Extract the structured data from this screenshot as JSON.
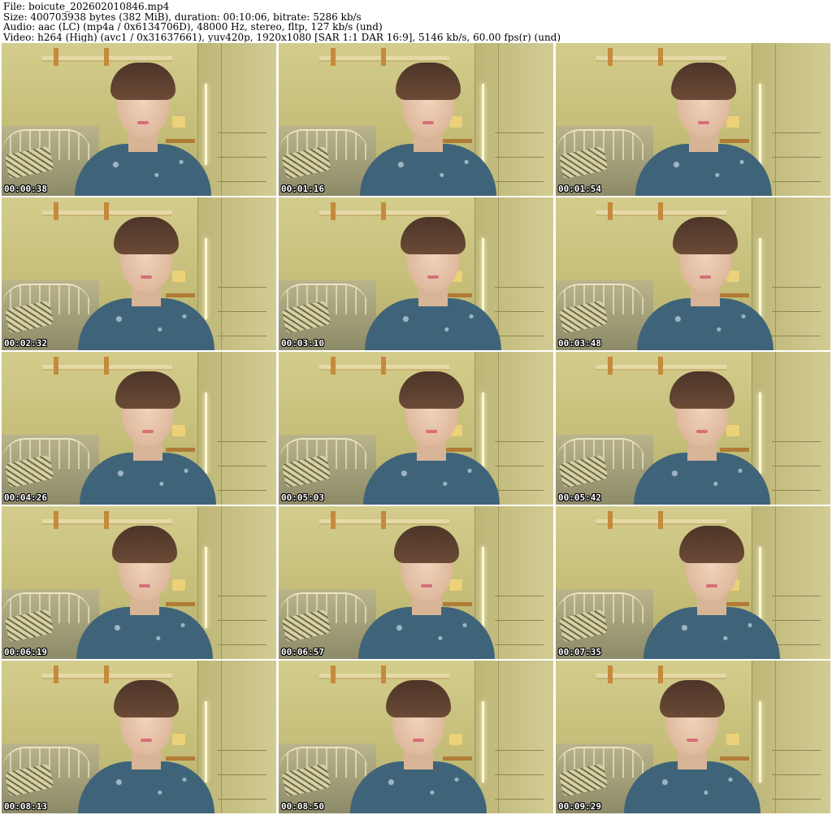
{
  "header": {
    "file": "File: boicute_202602010846.mp4",
    "size": "Size: 400703938 bytes (382 MiB), duration: 00:10:06, bitrate: 5286 kb/s",
    "audio": "Audio: aac (LC) (mp4a / 0x6134706D), 48000 Hz, stereo, fltp, 127 kb/s (und)",
    "video": "Video: h264 (High) (avc1 / 0x31637661), yuv420p, 1920x1080 [SAR 1:1 DAR 16:9], 5146 kb/s, 60.00 fps(r) (und)"
  },
  "thumbnails": [
    {
      "timestamp": "00:00:38"
    },
    {
      "timestamp": "00:01:16"
    },
    {
      "timestamp": "00:01:54"
    },
    {
      "timestamp": "00:02:32"
    },
    {
      "timestamp": "00:03:10"
    },
    {
      "timestamp": "00:03:48"
    },
    {
      "timestamp": "00:04:26"
    },
    {
      "timestamp": "00:05:03"
    },
    {
      "timestamp": "00:05:42"
    },
    {
      "timestamp": "00:06:19"
    },
    {
      "timestamp": "00:06:57"
    },
    {
      "timestamp": "00:07:35"
    },
    {
      "timestamp": "00:08:13"
    },
    {
      "timestamp": "00:08:50"
    },
    {
      "timestamp": "00:09:29"
    }
  ]
}
